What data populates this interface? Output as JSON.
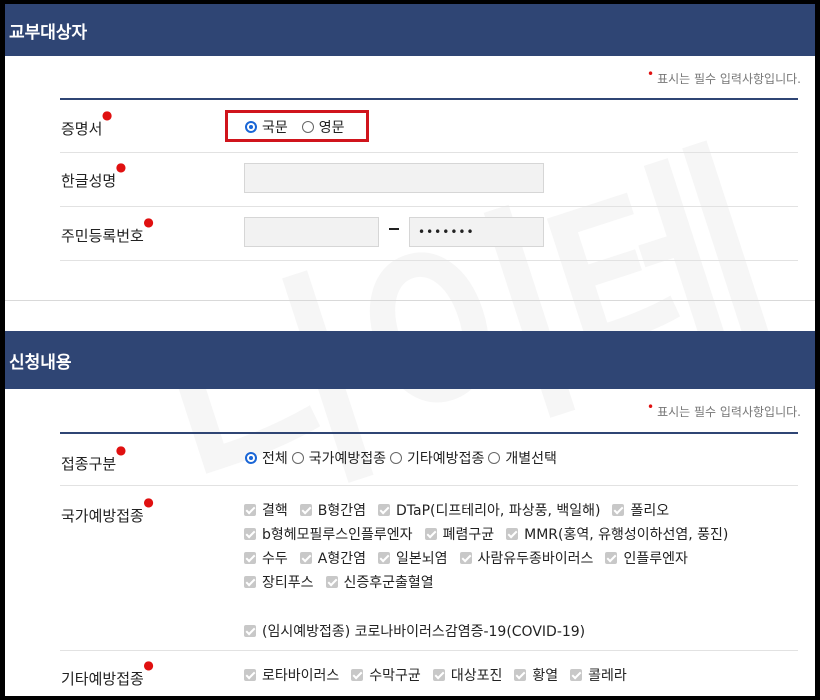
{
  "section1": {
    "title": "교부대상자",
    "required_note": "표시는 필수 입력사항입니다."
  },
  "fields": {
    "certificate": {
      "label": "증명서",
      "options": [
        "국문",
        "영문"
      ],
      "selected": "국문"
    },
    "korean_name": {
      "label": "한글성명",
      "value": ""
    },
    "resident_number": {
      "label": "주민등록번호",
      "first": "",
      "separator": "-",
      "second": "•••••••"
    }
  },
  "section2": {
    "title": "신청내용",
    "required_note": "표시는 필수 입력사항입니다."
  },
  "vaccination_type": {
    "label": "접종구분",
    "options": [
      "전체",
      "국가예방접종",
      "기타예방접종",
      "개별선택"
    ],
    "selected": "전체"
  },
  "national": {
    "label": "국가예방접종",
    "rows": [
      [
        "결핵",
        "B형간염",
        "DTaP(디프테리아, 파상풍, 백일해)",
        "폴리오"
      ],
      [
        "b형헤모필루스인플루엔자",
        "폐렴구균",
        "MMR(홍역, 유행성이하선염, 풍진)"
      ],
      [
        "수두",
        "A형간염",
        "일본뇌염",
        "사람유두종바이러스",
        "인플루엔자"
      ],
      [
        "장티푸스",
        "신증후군출혈열"
      ],
      [
        "(임시예방접종) 코로나바이러스감염증-19(COVID-19)"
      ]
    ]
  },
  "other": {
    "label": "기타예방접종",
    "items": [
      "로타바이러스",
      "수막구균",
      "대상포진",
      "황열",
      "콜레라"
    ]
  },
  "watermark": "나이테"
}
